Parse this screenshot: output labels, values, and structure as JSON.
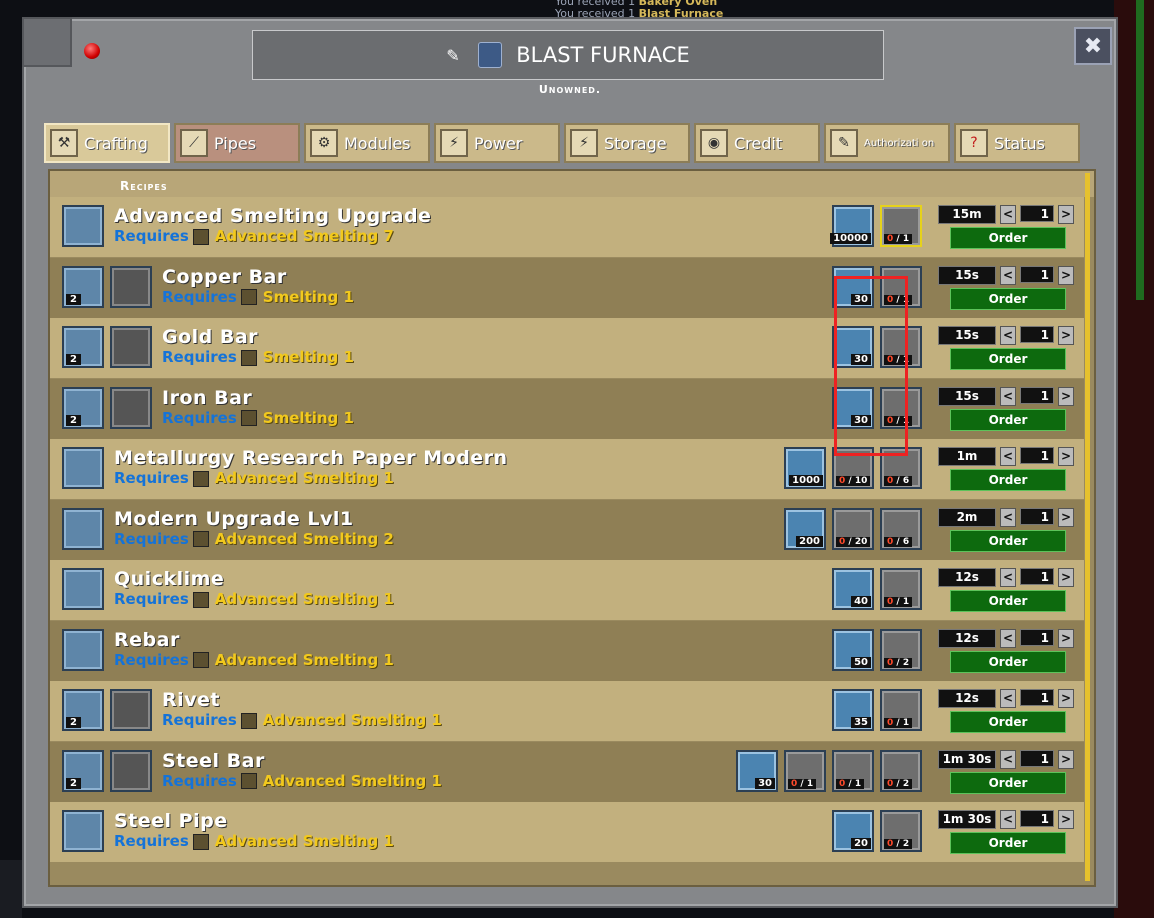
{
  "notifications": [
    {
      "prefix": "You received 1",
      "item": "Bakery Oven"
    },
    {
      "prefix": "You received 1",
      "item": "Blast Furnace"
    }
  ],
  "window": {
    "title": "BLAST FURNACE",
    "owner_status": "Unowned.",
    "close_label": "✖"
  },
  "tabs": [
    {
      "label": "Crafting",
      "icon": "crafting-icon",
      "active": true
    },
    {
      "label": "Pipes",
      "icon": "pipes-icon"
    },
    {
      "label": "Modules",
      "icon": "modules-icon"
    },
    {
      "label": "Power",
      "icon": "power-icon"
    },
    {
      "label": "Storage",
      "icon": "storage-icon"
    },
    {
      "label": "Credit",
      "icon": "credit-icon"
    },
    {
      "label": "Authorizati on",
      "icon": "authorization-icon"
    },
    {
      "label": "Status",
      "icon": "status-icon"
    }
  ],
  "recipes_header": "Recipes",
  "requires_label": "Requires",
  "order_label": "Order",
  "recipes": [
    {
      "name": "Advanced Smelting Upgrade",
      "skill": "Advanced Smelting 7",
      "ingredients": [
        {
          "type": "fuel",
          "qty": "10000"
        },
        {
          "type": "mat",
          "need": "0",
          "have": "1"
        }
      ],
      "time": "15m",
      "quantity": "1"
    },
    {
      "name": "Copper Bar",
      "out_qty": "2",
      "skill": "Smelting 1",
      "ingredients": [
        {
          "type": "fuel",
          "qty": "30"
        },
        {
          "type": "mat",
          "need": "0",
          "have": "1"
        }
      ],
      "time": "15s",
      "quantity": "1"
    },
    {
      "name": "Gold Bar",
      "out_qty": "2",
      "skill": "Smelting 1",
      "ingredients": [
        {
          "type": "fuel",
          "qty": "30"
        },
        {
          "type": "mat",
          "need": "0",
          "have": "1"
        }
      ],
      "time": "15s",
      "quantity": "1"
    },
    {
      "name": "Iron Bar",
      "out_qty": "2",
      "skill": "Smelting 1",
      "ingredients": [
        {
          "type": "fuel",
          "qty": "30"
        },
        {
          "type": "mat",
          "need": "0",
          "have": "1"
        }
      ],
      "time": "15s",
      "quantity": "1"
    },
    {
      "name": "Metallurgy Research Paper Modern",
      "skill": "Advanced Smelting 1",
      "ingredients": [
        {
          "type": "fuel",
          "qty": "1000"
        },
        {
          "type": "mat",
          "need": "0",
          "have": "10"
        },
        {
          "type": "mat",
          "need": "0",
          "have": "6"
        }
      ],
      "time": "1m",
      "quantity": "1"
    },
    {
      "name": "Modern Upgrade Lvl1",
      "skill": "Advanced Smelting 2",
      "ingredients": [
        {
          "type": "fuel",
          "qty": "200"
        },
        {
          "type": "mat",
          "need": "0",
          "have": "20"
        },
        {
          "type": "mat",
          "need": "0",
          "have": "6"
        }
      ],
      "time": "2m",
      "quantity": "1"
    },
    {
      "name": "Quicklime",
      "skill": "Advanced Smelting 1",
      "ingredients": [
        {
          "type": "fuel",
          "qty": "40"
        },
        {
          "type": "mat",
          "need": "0",
          "have": "1"
        }
      ],
      "time": "12s",
      "quantity": "1"
    },
    {
      "name": "Rebar",
      "skill": "Advanced Smelting 1",
      "ingredients": [
        {
          "type": "fuel",
          "qty": "50"
        },
        {
          "type": "mat",
          "need": "0",
          "have": "2"
        }
      ],
      "time": "12s",
      "quantity": "1"
    },
    {
      "name": "Rivet",
      "out_qty": "2",
      "skill": "Advanced Smelting 1",
      "ingredients": [
        {
          "type": "fuel",
          "qty": "35"
        },
        {
          "type": "mat",
          "need": "0",
          "have": "1"
        }
      ],
      "time": "12s",
      "quantity": "1"
    },
    {
      "name": "Steel Bar",
      "out_qty": "2",
      "skill": "Advanced Smelting 1",
      "ingredients": [
        {
          "type": "fuel",
          "qty": "30"
        },
        {
          "type": "mat",
          "need": "0",
          "have": "1"
        },
        {
          "type": "mat",
          "need": "0",
          "have": "1"
        },
        {
          "type": "mat",
          "need": "0",
          "have": "2"
        }
      ],
      "time": "1m 30s",
      "quantity": "1"
    },
    {
      "name": "Steel Pipe",
      "skill": "Advanced Smelting 1",
      "ingredients": [
        {
          "type": "fuel",
          "qty": "20"
        },
        {
          "type": "mat",
          "need": "0",
          "have": "2"
        }
      ],
      "time": "1m 30s",
      "quantity": "1"
    }
  ],
  "colors": {
    "requires": "#1573d8",
    "skill": "#f2c91d",
    "order": "#0d6a0e",
    "highlight": "#ee2222"
  }
}
